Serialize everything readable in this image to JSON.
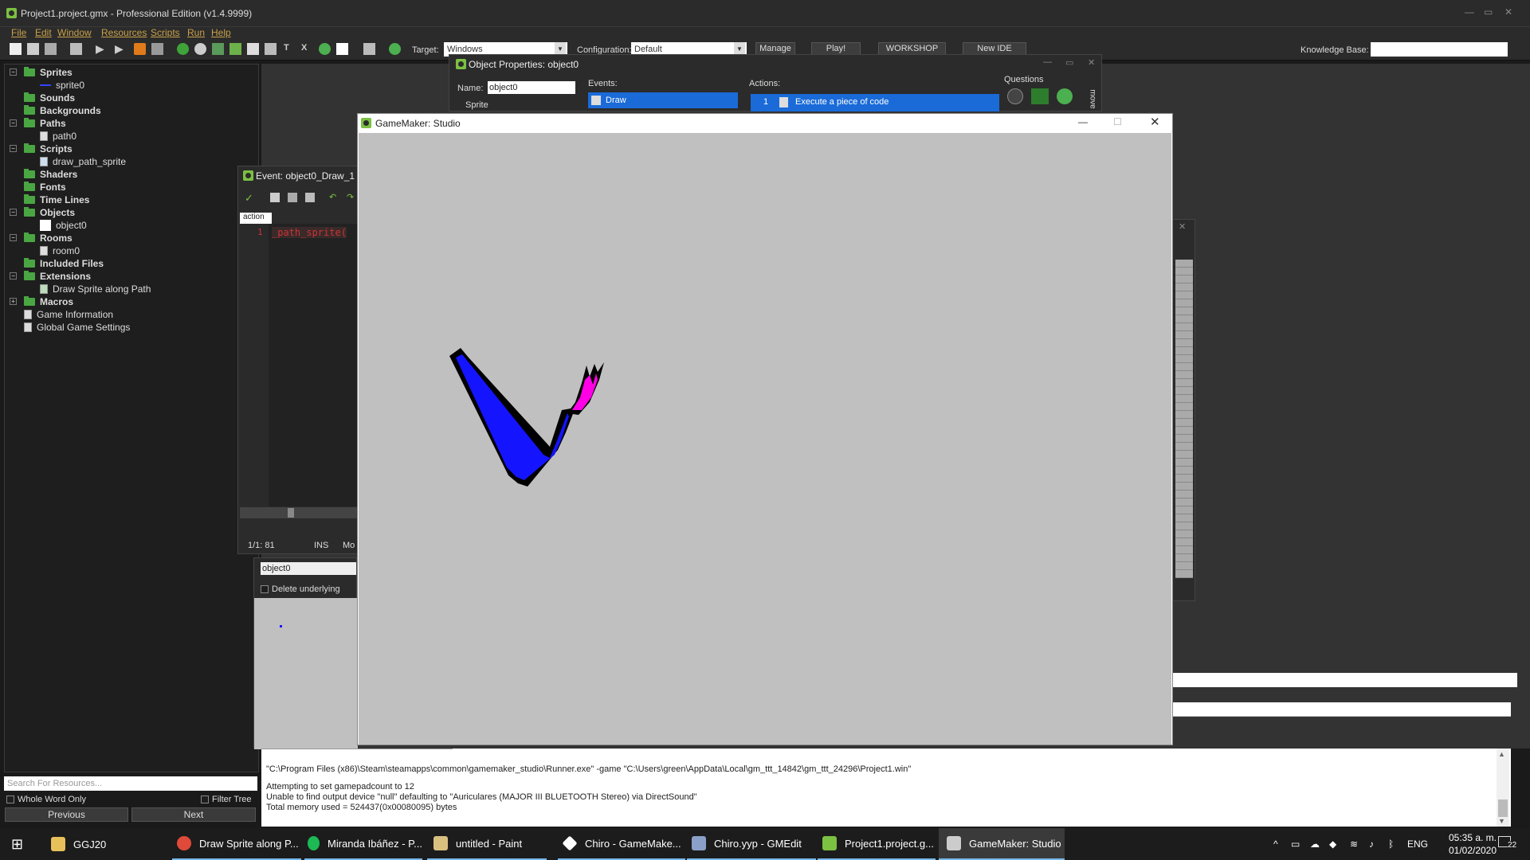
{
  "window": {
    "title": "Project1.project.gmx  -  Professional Edition (v1.4.9999)"
  },
  "menu": [
    "File",
    "Edit",
    "Window",
    "Resources",
    "Scripts",
    "Run",
    "Help"
  ],
  "toolbar": {
    "target_label": "Target:",
    "target_value": "Windows",
    "config_label": "Configuration:",
    "config_value": "Default",
    "manage": "Manage",
    "play": "Play!",
    "workshop": "WORKSHOP",
    "newide": "New IDE",
    "kb_label": "Knowledge Base:"
  },
  "tree": {
    "sprites": "Sprites",
    "sprite0": "sprite0",
    "sounds": "Sounds",
    "backgrounds": "Backgrounds",
    "paths": "Paths",
    "path0": "path0",
    "scripts": "Scripts",
    "script0": "draw_path_sprite",
    "shaders": "Shaders",
    "fonts": "Fonts",
    "timelines": "Time Lines",
    "objects": "Objects",
    "object0": "object0",
    "rooms": "Rooms",
    "room0": "room0",
    "included": "Included Files",
    "extensions": "Extensions",
    "ext0": "Draw Sprite along Path",
    "macros": "Macros",
    "gameinfo": "Game Information",
    "settings": "Global Game Settings"
  },
  "search": {
    "placeholder": "Search For Resources...",
    "whole_word": "Whole Word Only",
    "filter": "Filter Tree",
    "previous": "Previous",
    "next": "Next"
  },
  "event_editor": {
    "title": "Event: object0_Draw_1",
    "tab": "action",
    "line": "1",
    "code": "_path_sprite(",
    "status_pos": "1/1: 81",
    "status_ins": "INS",
    "status_mode": "Mo"
  },
  "object_props": {
    "title": "Object Properties: object0",
    "name_label": "Name:",
    "name_value": "object0",
    "sprite_label": "Sprite",
    "events_label": "Events:",
    "event_draw": "Draw",
    "actions_label": "Actions:",
    "action_num": "1",
    "action_code": "Execute a piece of code",
    "questions": "Questions",
    "move": "move"
  },
  "room_panel": {
    "object_value": "object0",
    "delete_underlying": "Delete underlying"
  },
  "game_window": {
    "title": "GameMaker: Studio"
  },
  "output": [
    "\"C:\\Program Files (x86)\\Steam\\steamapps\\common\\gamemaker_studio\\Runner.exe\"  -game \"C:\\Users\\green\\AppData\\Local\\gm_ttt_14842\\gm_ttt_24296\\Project1.win\"",
    "Attempting to set gamepadcount to 12",
    "Unable to find output device \"null\" defaulting to \"Auriculares (MAJOR III BLUETOOTH Stereo) via DirectSound\"",
    "Total memory used = 524437(0x00080095) bytes"
  ],
  "taskbar": {
    "items": [
      "GGJ20",
      "Draw Sprite along P...",
      "Miranda Ibáñez - P...",
      "untitled - Paint",
      "Chiro - GameMake...",
      "Chiro.yyp - GMEdit",
      "Project1.project.g...",
      "GameMaker: Studio"
    ],
    "lang": "ENG",
    "time": "05:35 a. m.",
    "date": "01/02/2020",
    "notif": "22"
  },
  "colors": {
    "blue": "#1414ff",
    "magenta": "#ff00e6",
    "canvas": "#c0c0c0",
    "accent": "#76b9ed"
  }
}
